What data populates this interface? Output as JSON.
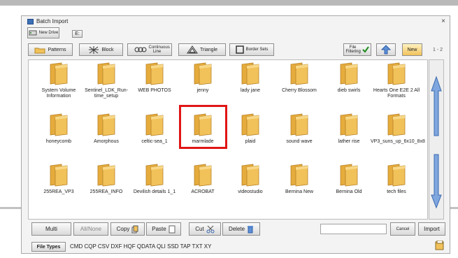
{
  "dialog": {
    "title": "Batch Import",
    "close_glyph": "×"
  },
  "top": {
    "new_drive_label": "New Drive",
    "drive_letter": "E:"
  },
  "toolbar": {
    "patterns": "Patterns",
    "block": "Block",
    "continuous_line": "Continuous Line",
    "triangle": "Triangle",
    "border_sets": "Border Sets",
    "file_filtering": "File Filtering",
    "new_folder": "New",
    "page": "1 - 2"
  },
  "folders": [
    {
      "name": "System Volume Information"
    },
    {
      "name": "Sentinel_LDK_Run-time_setup",
      "line1": "Sentinel_LDK_R",
      "line2": "un-time_setup"
    },
    {
      "name": "WEB PHOTOS"
    },
    {
      "name": "jenny"
    },
    {
      "name": "lady jane"
    },
    {
      "name": "Cherry Blossom"
    },
    {
      "name": "dieb swirls"
    },
    {
      "name": "Hearts One E2E 2 All Formats"
    },
    {
      "name": "honeycomb"
    },
    {
      "name": "Amorphous"
    },
    {
      "name": "celtic-sea_1"
    },
    {
      "name": "marmlade"
    },
    {
      "name": "plaid"
    },
    {
      "name": "sound wave"
    },
    {
      "name": "lather rise"
    },
    {
      "name": "VP3_suns_up_6x10_8x8"
    },
    {
      "name": "255REA_VP3"
    },
    {
      "name": "255REA_INFO"
    },
    {
      "name": "Devilish details 1_1"
    },
    {
      "name": "ACROBAT"
    },
    {
      "name": "videostudio"
    },
    {
      "name": "Bernina New"
    },
    {
      "name": "Bernina Old"
    },
    {
      "name": "tech files"
    }
  ],
  "bottom": {
    "multi": "Multi",
    "all_none": "All/None",
    "copy": "Copy",
    "paste": "Paste",
    "cut": "Cut",
    "delete": "Delete",
    "cancel": "Cancel",
    "import": "Import",
    "file_types_label": "File Types",
    "file_types_list": "CMD CQP CSV DXF HQF QDATA QLI SSD TAP TXT XY",
    "search_value": ""
  },
  "colors": {
    "folder": "#f2c25a",
    "highlight": "#e01515",
    "scroll_arrow": "#7fa6de"
  }
}
